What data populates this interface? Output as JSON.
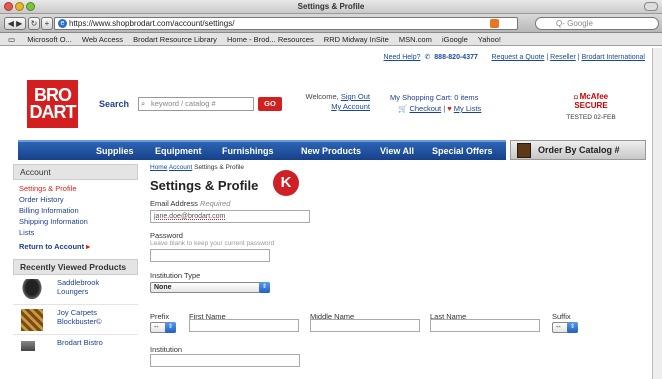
{
  "browser": {
    "window_title": "Settings & Profile",
    "url": "https://www.shopbrodart.com/account/settings/",
    "search_placeholder": "Q- Google",
    "bookmarks": [
      "Microsoft O...",
      "Web Access",
      "Brodart Resource Library",
      "Home - Brod... Resources",
      "RRD Midway InSite",
      "MSN.com",
      "iGoogle",
      "Yahoo!"
    ]
  },
  "toplinks": {
    "help": "Need Help?",
    "phone": "888-820-4377",
    "quote": "Request a Quote",
    "reseller": "Reseller",
    "intl": "Brodart International"
  },
  "header": {
    "logo_line1": "BRO",
    "logo_line2": "DART",
    "search_label": "Search",
    "search_placeholder": "keyword / catalog #",
    "go": "GO",
    "welcome": "Welcome,",
    "signout": "Sign Out",
    "my_account": "My Account",
    "cart_title": "My Shopping Cart: 0 items",
    "checkout": "Checkout",
    "my_lists": "My Lists",
    "mcafee_brand": "McAfee",
    "mcafee_secure": "SECURE",
    "mcafee_tested": "TESTED 02-FEB"
  },
  "nav": [
    "Supplies",
    "Equipment",
    "Furnishings",
    "New Products",
    "View All",
    "Special Offers"
  ],
  "catalog_button": "Order By Catalog #",
  "sidebar": {
    "heading": "Account",
    "items": [
      "Settings & Profile",
      "Order History",
      "Billing Information",
      "Shipping Information",
      "Lists"
    ],
    "return": "Return to Account",
    "recent_heading": "Recently Viewed Products",
    "recent": [
      {
        "line1": "Saddlebrook",
        "line2": "Loungers"
      },
      {
        "line1": "Joy Carpets",
        "line2": "Blockbuster©"
      },
      {
        "line1": "Brodart Bistro",
        "line2": ""
      }
    ]
  },
  "main": {
    "crumb_home": "Home",
    "crumb_account": "Account",
    "crumb_current": "Settings & Profile",
    "title": "Settings & Profile",
    "email_label": "Email Address",
    "email_required": "Required",
    "email_value": "jane.doe@brodart.com",
    "password_label": "Password",
    "password_hint": "Leave blank to keep your current password",
    "institution_type_label": "Institution Type",
    "institution_type_value": "None",
    "prefix_label": "Prefix",
    "prefix_value": "--",
    "first_label": "First Name",
    "middle_label": "Middle Name",
    "last_label": "Last Name",
    "suffix_label": "Suffix",
    "suffix_value": "--",
    "institution_label": "Institution"
  },
  "badge": "K"
}
